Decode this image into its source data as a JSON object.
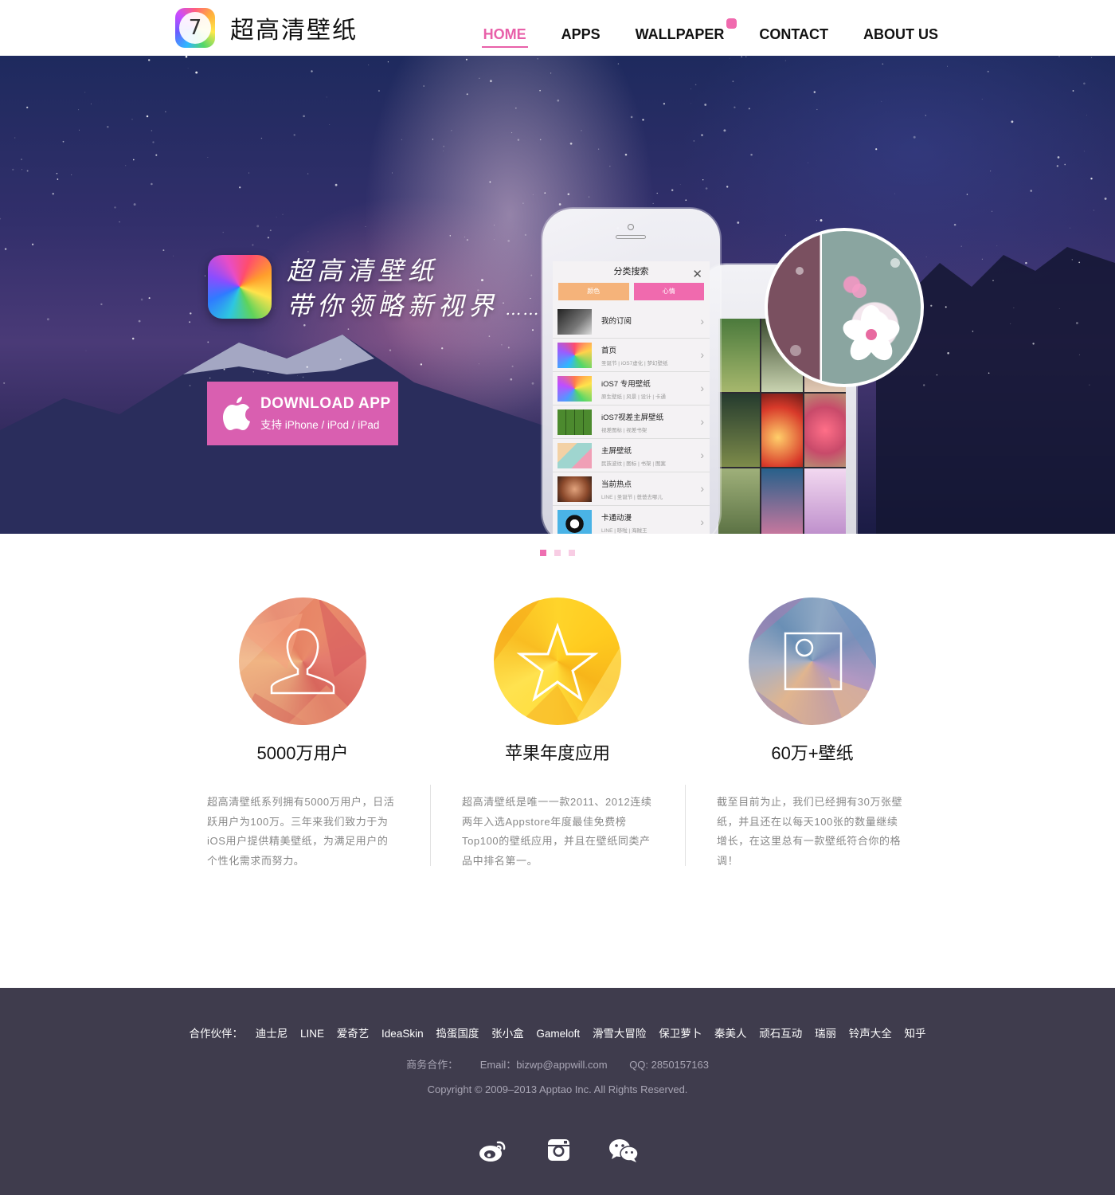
{
  "header": {
    "logo_icon_text": "7",
    "logo_text": "超高清壁纸",
    "nav": [
      {
        "label": "HOME",
        "active": true
      },
      {
        "label": "APPS",
        "active": false
      },
      {
        "label": "WALLPAPER",
        "active": false,
        "badge": true
      },
      {
        "label": "CONTACT",
        "active": false
      },
      {
        "label": "ABOUT US",
        "active": false
      }
    ]
  },
  "hero": {
    "tagline_line1": "超高清壁纸",
    "tagline_line2": "带你领略新视界",
    "download": {
      "title": "DOWNLOAD APP",
      "subtitle": "支持 iPhone / iPod / iPad"
    },
    "phone": {
      "screen_title": "分类搜索",
      "tabs": [
        "颜色",
        "心情"
      ],
      "items": [
        {
          "name": "我的订阅",
          "desc": ""
        },
        {
          "name": "首页",
          "desc": "圣诞节 | iOS7虚化 | 梦幻壁纸"
        },
        {
          "name": "iOS7 专用壁纸",
          "desc": "原生壁纸 | 风景 | 设计 | 卡通"
        },
        {
          "name": "iOS7视差主屏壁纸",
          "desc": "视差图标 | 视差书架"
        },
        {
          "name": "主屏壁纸",
          "desc": "民族波纹 | 图标 | 书架 | 图案"
        },
        {
          "name": "当前热点",
          "desc": "LINE | 圣诞节 | 爸爸去哪儿"
        },
        {
          "name": "卡通动漫",
          "desc": "LINE | 哆啦 | 海贼王"
        }
      ]
    },
    "slides_total": 3,
    "slide_active": 1
  },
  "features": [
    {
      "icon": "user-icon",
      "title": "5000万用户",
      "text": "超高清壁纸系列拥有5000万用户，日活跃用户为100万。三年来我们致力于为iOS用户提供精美壁纸，为满足用户的个性化需求而努力。"
    },
    {
      "icon": "star-icon",
      "title": "苹果年度应用",
      "text": "超高清壁纸是唯一一款2011、2012连续两年入选Appstore年度最佳免费榜Top100的壁纸应用，并且在壁纸同类产品中排名第一。"
    },
    {
      "icon": "wallpaper-icon",
      "title": "60万+壁纸",
      "text": "截至目前为止，我们已经拥有30万张壁纸，并且还在以每天100张的数量继续增长，在这里总有一款壁纸符合你的格调！"
    }
  ],
  "footer": {
    "partners_label": "合作伙伴：",
    "partners": [
      "迪士尼",
      "LINE",
      "爱奇艺",
      "IdeaSkin",
      "捣蛋国度",
      "张小盒",
      "Gameloft",
      "滑雪大冒险",
      "保卫萝卜",
      "秦美人",
      "顽石互动",
      "瑞丽",
      "铃声大全",
      "知乎"
    ],
    "business_label": "商务合作：",
    "email": "Email：bizwp@appwill.com",
    "qq": "QQ: 2850157163",
    "copyright": "Copyright © 2009–2013 Apptao Inc. All Rights Reserved.",
    "social": [
      "weibo-icon",
      "instagram-icon",
      "wechat-icon"
    ]
  },
  "colors": {
    "accent": "#e860a9",
    "download_button": "#d95fb0",
    "footer_bg": "#3f3c4d"
  }
}
